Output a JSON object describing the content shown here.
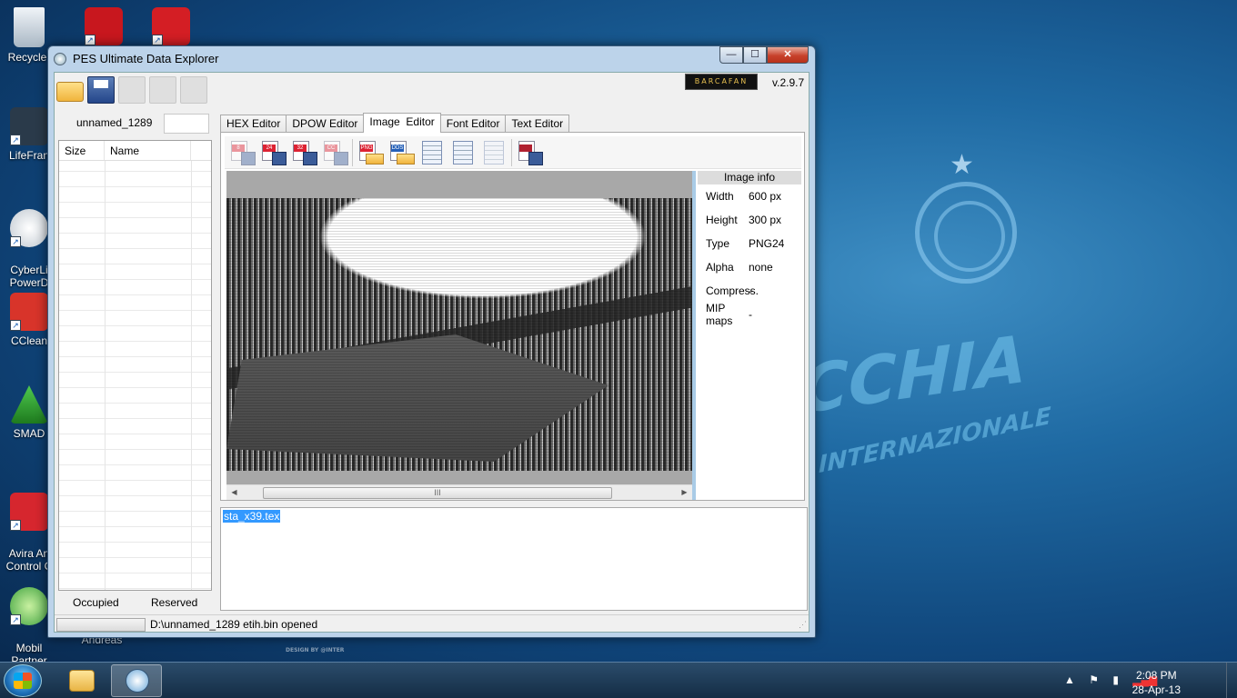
{
  "desktop": {
    "icons": [
      {
        "label": "Recycle"
      },
      {
        "label": "LifeFran"
      },
      {
        "label": "CyberLi\nPowerD"
      },
      {
        "label": "CClean"
      },
      {
        "label": "SMAD"
      },
      {
        "label": "Avira An\nControl C"
      },
      {
        "label": "Mobil\nPartner"
      }
    ],
    "under_window_label": "Andreas",
    "wallpaper": {
      "big": "CCHIA",
      "small": "INTERNAZIONALE",
      "credit": "DESIGN BY @INTER"
    }
  },
  "window": {
    "title": "PES Ultimate Data Explorer",
    "brand": "BARCAFAN",
    "version": "v.2.9.7",
    "controls": {
      "minimize": "—",
      "maximize": "☐",
      "close": "✕"
    }
  },
  "left_panel": {
    "file_name": "unnamed_1289",
    "file_name_box": "",
    "columns": [
      "Size",
      "Name"
    ],
    "footer": {
      "occupied": "Occupied",
      "reserved": "Reserved"
    }
  },
  "tabs": [
    {
      "label": "HEX Editor",
      "active": false
    },
    {
      "label": "DPOW Editor",
      "active": false
    },
    {
      "label": "Image  Editor",
      "active": true
    },
    {
      "label": "Font Editor",
      "active": false
    },
    {
      "label": "Text Editor",
      "active": false
    }
  ],
  "image_toolbar": {
    "buttons": [
      "8",
      "24",
      "32",
      "CC",
      "PNG",
      "DDS",
      "export-view",
      "import-palette",
      "reverse",
      "preview"
    ]
  },
  "image_info": {
    "header": "Image info",
    "rows": [
      {
        "key": "Width",
        "value": "600 px"
      },
      {
        "key": "Height",
        "value": "300 px"
      },
      {
        "key": "Type",
        "value": "PNG24"
      },
      {
        "key": "Alpha",
        "value": "none"
      },
      {
        "key": "Compress.",
        "value": "-"
      },
      {
        "key": "MIP maps",
        "value": "-"
      }
    ]
  },
  "scrollbar": {
    "left": "◀",
    "right": "▶",
    "thumb": "III"
  },
  "log": {
    "selected_text": "sta_x39.tex"
  },
  "status": {
    "text": "D:\\unnamed_1289 etih.bin opened"
  },
  "taskbar": {
    "time": "2:08 PM",
    "date": "28-Apr-13"
  },
  "colors": {
    "selection": "#3399ff",
    "window_frame": "#bcd3ea",
    "close_button": "#c7412b"
  }
}
